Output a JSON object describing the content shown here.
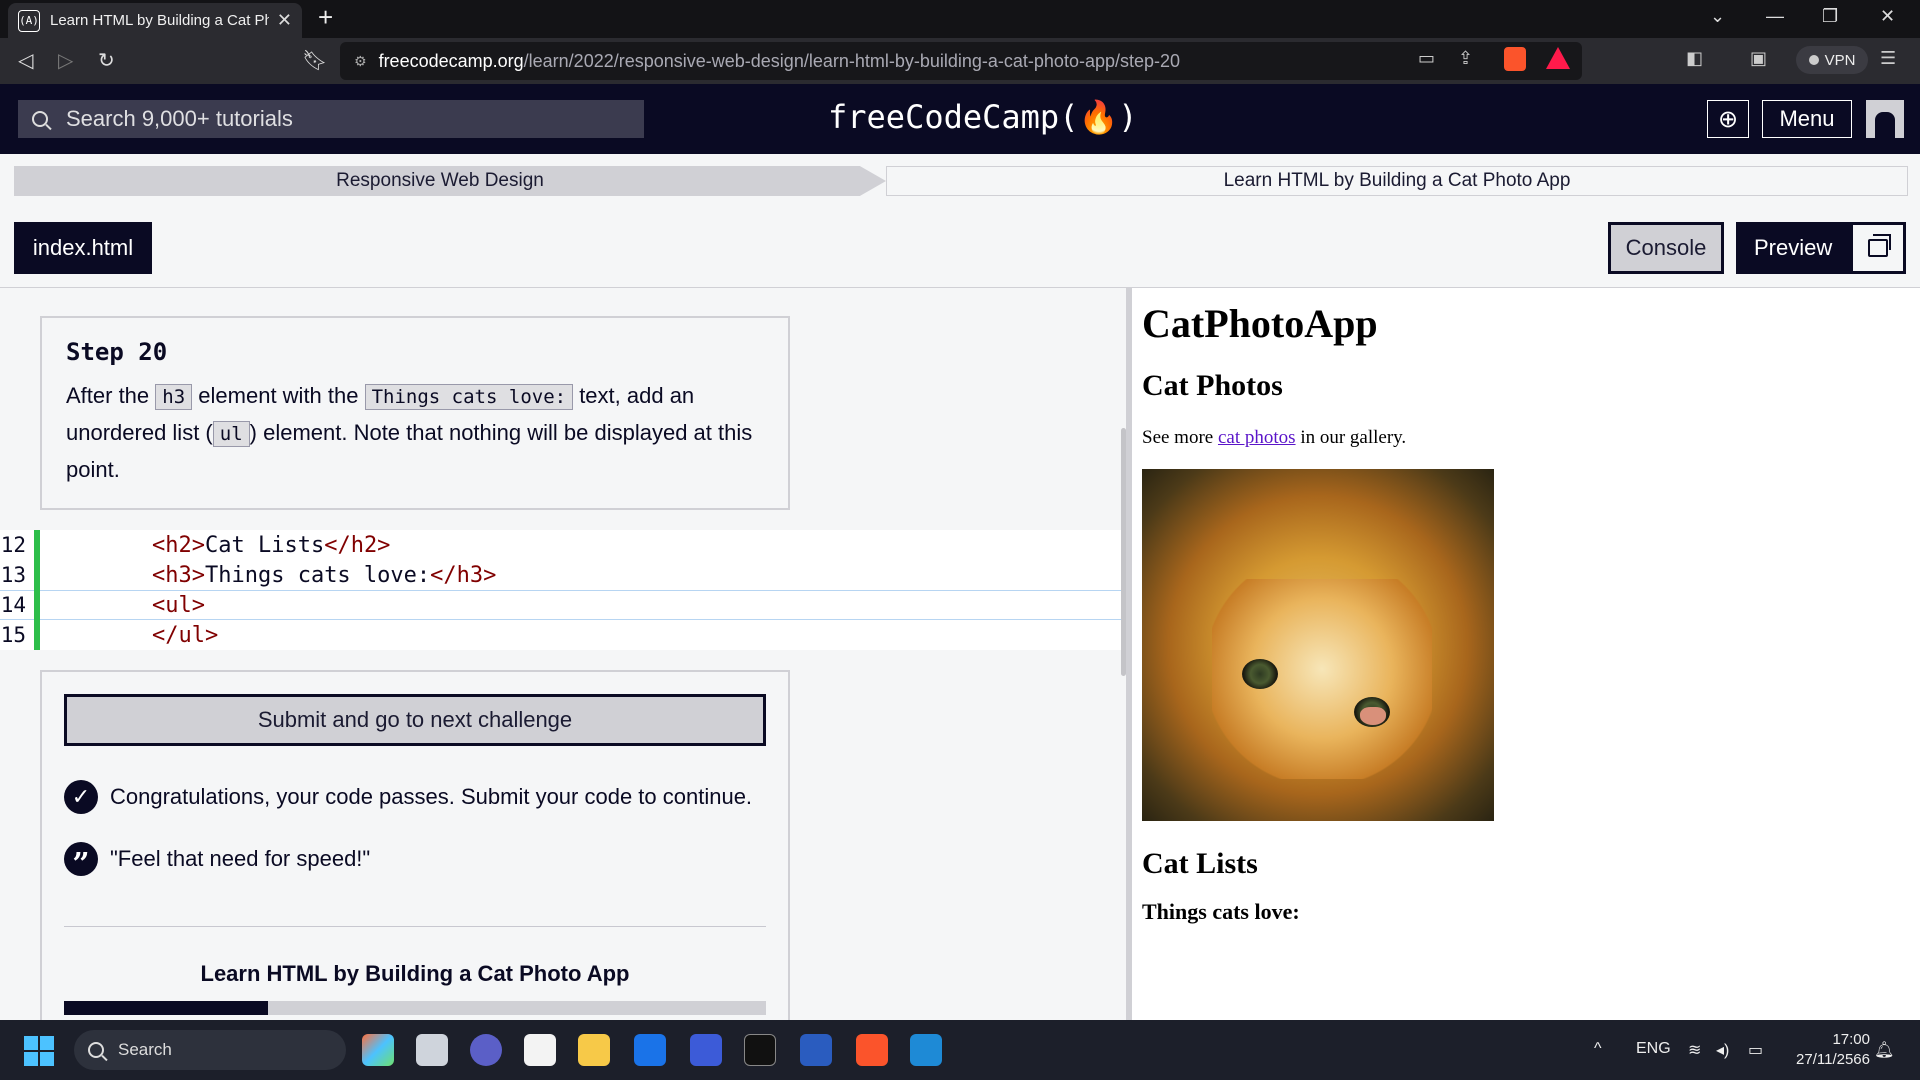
{
  "browser": {
    "tab_title": "Learn HTML by Building a Cat Ph",
    "tab_favicon": "(A)",
    "url_host": "freecodecamp.org",
    "url_path": "/learn/2022/responsive-web-design/learn-html-by-building-a-cat-photo-app/step-20",
    "vpn_label": "VPN"
  },
  "nav": {
    "search_placeholder": "Search 9,000+ tutorials",
    "logo": "freeCodeCamp(🔥)",
    "menu_label": "Menu"
  },
  "breadcrumb": {
    "superblock": "Responsive Web Design",
    "block": "Learn HTML by Building a Cat Photo App"
  },
  "editor_tabs": {
    "file": "index.html",
    "console": "Console",
    "preview": "Preview"
  },
  "description": {
    "step_title": "Step 20",
    "p1": "After the ",
    "code1": "h3",
    "p2": " element with the ",
    "code2": "Things cats love:",
    "p3": " text, add an unordered list (",
    "code3": "ul",
    "p4": ") element. Note that nothing will be displayed at this point."
  },
  "editor": {
    "lines": [
      {
        "num": "12",
        "open": "<h2>",
        "text": "Cat Lists",
        "close": "</h2>"
      },
      {
        "num": "13",
        "open": "<h3>",
        "text": "Things cats love:",
        "close": "</h3>"
      },
      {
        "num": "14",
        "open": "<ul>",
        "text": "",
        "close": ""
      },
      {
        "num": "15",
        "open": "</ul>",
        "text": "",
        "close": ""
      }
    ]
  },
  "result": {
    "submit_label": "Submit and go to next challenge",
    "success_msg": "Congratulations, your code passes. Submit your code to continue.",
    "quote": "\"Feel that need for speed!\"",
    "project_title": "Learn HTML by Building a Cat Photo App",
    "progress_fraction": 0.29
  },
  "preview": {
    "h1": "CatPhotoApp",
    "h2_photos": "Cat Photos",
    "p_before": "See more ",
    "link": "cat photos",
    "p_after": " in our gallery.",
    "h2_lists": "Cat Lists",
    "h3": "Things cats love:"
  },
  "taskbar": {
    "search_label": "Search",
    "lang": "ENG",
    "time": "17:00",
    "date": "27/11/2566"
  }
}
